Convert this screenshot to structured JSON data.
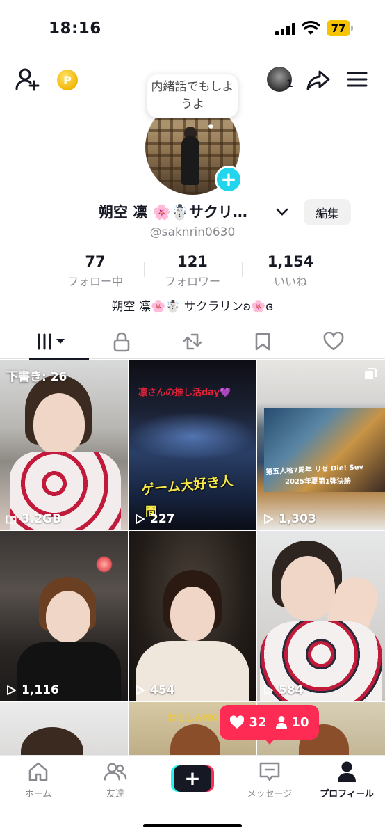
{
  "status_bar": {
    "time": "18:16",
    "battery": "77",
    "battery_color": "#f5c400"
  },
  "header": {
    "friend_badge_count": "1",
    "icons": [
      "add-friend-icon",
      "coin-icon",
      "friend-avatar",
      "share-icon",
      "menu-icon"
    ]
  },
  "profile": {
    "bubble_note": "内緒話でもしようよ",
    "display_name": "朔空 凛 🌸☃️サクリ…",
    "username": "@saknrin0630",
    "edit_label": "編集",
    "bio": "朔空 凛🌸☃️ サクラリンʚ🌸ɞ"
  },
  "stats": [
    {
      "value": "77",
      "label": "フォロー中"
    },
    {
      "value": "121",
      "label": "フォロワー"
    },
    {
      "value": "1,154",
      "label": "いいね"
    }
  ],
  "tabs": [
    {
      "name": "videos",
      "icon": "grid-icon",
      "active": true
    },
    {
      "name": "private",
      "icon": "lock-icon",
      "active": false
    },
    {
      "name": "reposts",
      "icon": "repost-icon",
      "active": false
    },
    {
      "name": "favorites",
      "icon": "bookmark-icon",
      "active": false
    },
    {
      "name": "liked",
      "icon": "heart-icon",
      "active": false
    }
  ],
  "grid": {
    "tiles": [
      {
        "label": "下書き: 26",
        "count": "3.2GB",
        "count_icon": "folder-icon"
      },
      {
        "overlay_top": "凛さんの推し活day💜",
        "overlay_main": "ゲーム大好き人",
        "overlay_sub": "間",
        "count": "227"
      },
      {
        "count": "1,303",
        "overlay_banner": "第五人格7周年 リゼ Die! Sev",
        "overlay_banner2": "2025年夏第1弾決勝"
      },
      {
        "count": "1,116"
      },
      {
        "count": "454"
      },
      {
        "count": "584"
      }
    ],
    "partial_overlay": "わちしみNG"
  },
  "live_pill": {
    "likes": "32",
    "viewers": "10",
    "color": "#fe2c55"
  },
  "bottom_nav": {
    "items": [
      {
        "label": "ホーム",
        "icon": "home-icon"
      },
      {
        "label": "友達",
        "icon": "friends-icon"
      },
      {
        "label": "",
        "icon": "create-icon"
      },
      {
        "label": "メッセージ",
        "icon": "inbox-icon"
      },
      {
        "label": "プロフィール",
        "icon": "profile-icon"
      }
    ]
  },
  "colors": {
    "accent_cyan": "#20d5ec",
    "brand_red": "#fe2c55",
    "brand_teal": "#25f4ee",
    "text_primary": "#161823",
    "text_secondary": "#8a8b91"
  }
}
